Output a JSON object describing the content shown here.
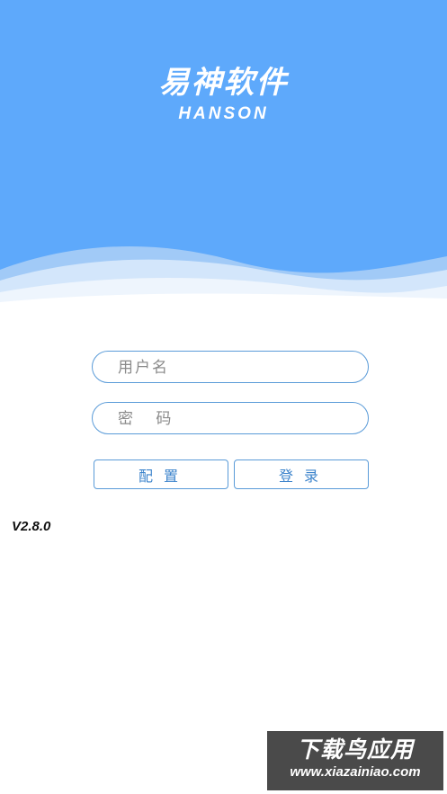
{
  "brand": {
    "name_cn": "易神软件",
    "name_en": "HANSON"
  },
  "login": {
    "username_placeholder": "用户名",
    "password_placeholder": "密 码",
    "config_label": "配置",
    "login_label": "登录"
  },
  "version": "V2.8.0",
  "watermark": {
    "text_cn": "下载鸟应用",
    "url": "www.xiazainiao.com"
  },
  "colors": {
    "header": "#5ea9fb",
    "accent": "#3d84cc",
    "border": "#5a9bd8"
  }
}
